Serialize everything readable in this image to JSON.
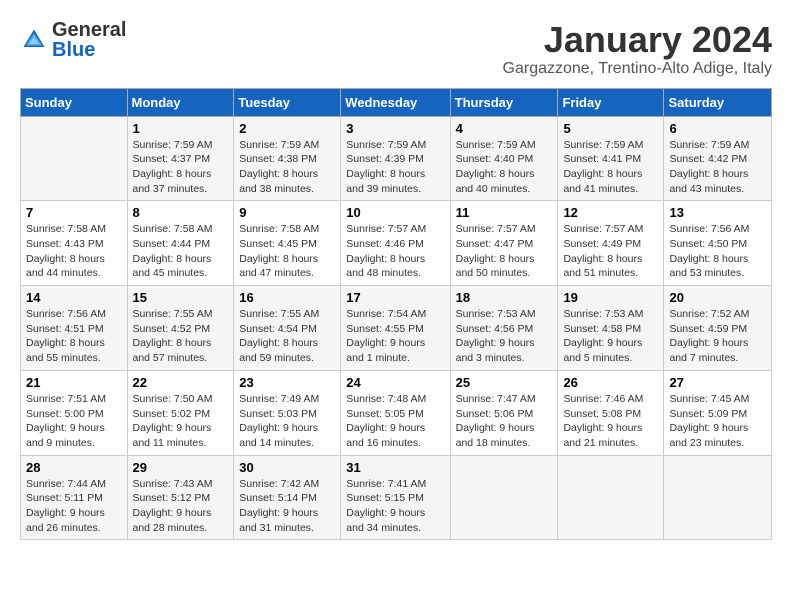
{
  "header": {
    "logo_general": "General",
    "logo_blue": "Blue",
    "month_title": "January 2024",
    "location": "Gargazzone, Trentino-Alto Adige, Italy"
  },
  "days_of_week": [
    "Sunday",
    "Monday",
    "Tuesday",
    "Wednesday",
    "Thursday",
    "Friday",
    "Saturday"
  ],
  "weeks": [
    [
      {
        "day": "",
        "info": ""
      },
      {
        "day": "1",
        "info": "Sunrise: 7:59 AM\nSunset: 4:37 PM\nDaylight: 8 hours\nand 37 minutes."
      },
      {
        "day": "2",
        "info": "Sunrise: 7:59 AM\nSunset: 4:38 PM\nDaylight: 8 hours\nand 38 minutes."
      },
      {
        "day": "3",
        "info": "Sunrise: 7:59 AM\nSunset: 4:39 PM\nDaylight: 8 hours\nand 39 minutes."
      },
      {
        "day": "4",
        "info": "Sunrise: 7:59 AM\nSunset: 4:40 PM\nDaylight: 8 hours\nand 40 minutes."
      },
      {
        "day": "5",
        "info": "Sunrise: 7:59 AM\nSunset: 4:41 PM\nDaylight: 8 hours\nand 41 minutes."
      },
      {
        "day": "6",
        "info": "Sunrise: 7:59 AM\nSunset: 4:42 PM\nDaylight: 8 hours\nand 43 minutes."
      }
    ],
    [
      {
        "day": "7",
        "info": "Sunrise: 7:58 AM\nSunset: 4:43 PM\nDaylight: 8 hours\nand 44 minutes."
      },
      {
        "day": "8",
        "info": "Sunrise: 7:58 AM\nSunset: 4:44 PM\nDaylight: 8 hours\nand 45 minutes."
      },
      {
        "day": "9",
        "info": "Sunrise: 7:58 AM\nSunset: 4:45 PM\nDaylight: 8 hours\nand 47 minutes."
      },
      {
        "day": "10",
        "info": "Sunrise: 7:57 AM\nSunset: 4:46 PM\nDaylight: 8 hours\nand 48 minutes."
      },
      {
        "day": "11",
        "info": "Sunrise: 7:57 AM\nSunset: 4:47 PM\nDaylight: 8 hours\nand 50 minutes."
      },
      {
        "day": "12",
        "info": "Sunrise: 7:57 AM\nSunset: 4:49 PM\nDaylight: 8 hours\nand 51 minutes."
      },
      {
        "day": "13",
        "info": "Sunrise: 7:56 AM\nSunset: 4:50 PM\nDaylight: 8 hours\nand 53 minutes."
      }
    ],
    [
      {
        "day": "14",
        "info": "Sunrise: 7:56 AM\nSunset: 4:51 PM\nDaylight: 8 hours\nand 55 minutes."
      },
      {
        "day": "15",
        "info": "Sunrise: 7:55 AM\nSunset: 4:52 PM\nDaylight: 8 hours\nand 57 minutes."
      },
      {
        "day": "16",
        "info": "Sunrise: 7:55 AM\nSunset: 4:54 PM\nDaylight: 8 hours\nand 59 minutes."
      },
      {
        "day": "17",
        "info": "Sunrise: 7:54 AM\nSunset: 4:55 PM\nDaylight: 9 hours\nand 1 minute."
      },
      {
        "day": "18",
        "info": "Sunrise: 7:53 AM\nSunset: 4:56 PM\nDaylight: 9 hours\nand 3 minutes."
      },
      {
        "day": "19",
        "info": "Sunrise: 7:53 AM\nSunset: 4:58 PM\nDaylight: 9 hours\nand 5 minutes."
      },
      {
        "day": "20",
        "info": "Sunrise: 7:52 AM\nSunset: 4:59 PM\nDaylight: 9 hours\nand 7 minutes."
      }
    ],
    [
      {
        "day": "21",
        "info": "Sunrise: 7:51 AM\nSunset: 5:00 PM\nDaylight: 9 hours\nand 9 minutes."
      },
      {
        "day": "22",
        "info": "Sunrise: 7:50 AM\nSunset: 5:02 PM\nDaylight: 9 hours\nand 11 minutes."
      },
      {
        "day": "23",
        "info": "Sunrise: 7:49 AM\nSunset: 5:03 PM\nDaylight: 9 hours\nand 14 minutes."
      },
      {
        "day": "24",
        "info": "Sunrise: 7:48 AM\nSunset: 5:05 PM\nDaylight: 9 hours\nand 16 minutes."
      },
      {
        "day": "25",
        "info": "Sunrise: 7:47 AM\nSunset: 5:06 PM\nDaylight: 9 hours\nand 18 minutes."
      },
      {
        "day": "26",
        "info": "Sunrise: 7:46 AM\nSunset: 5:08 PM\nDaylight: 9 hours\nand 21 minutes."
      },
      {
        "day": "27",
        "info": "Sunrise: 7:45 AM\nSunset: 5:09 PM\nDaylight: 9 hours\nand 23 minutes."
      }
    ],
    [
      {
        "day": "28",
        "info": "Sunrise: 7:44 AM\nSunset: 5:11 PM\nDaylight: 9 hours\nand 26 minutes."
      },
      {
        "day": "29",
        "info": "Sunrise: 7:43 AM\nSunset: 5:12 PM\nDaylight: 9 hours\nand 28 minutes."
      },
      {
        "day": "30",
        "info": "Sunrise: 7:42 AM\nSunset: 5:14 PM\nDaylight: 9 hours\nand 31 minutes."
      },
      {
        "day": "31",
        "info": "Sunrise: 7:41 AM\nSunset: 5:15 PM\nDaylight: 9 hours\nand 34 minutes."
      },
      {
        "day": "",
        "info": ""
      },
      {
        "day": "",
        "info": ""
      },
      {
        "day": "",
        "info": ""
      }
    ]
  ]
}
